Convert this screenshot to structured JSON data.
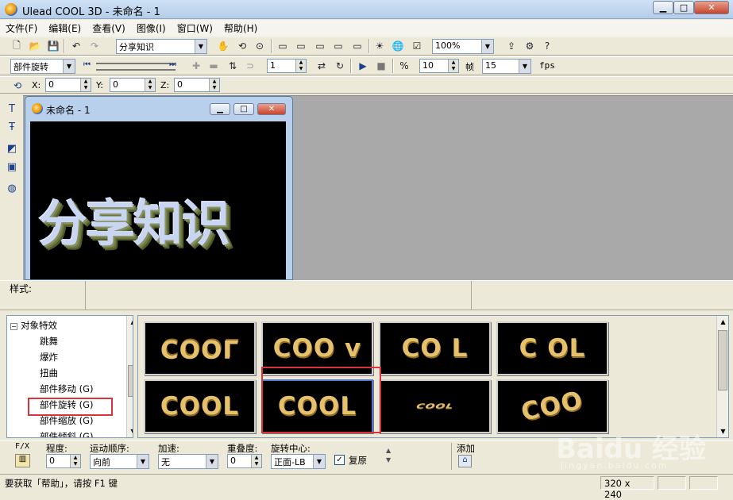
{
  "window": {
    "title": "Ulead COOL 3D - 未命名 - 1"
  },
  "menu": [
    "文件(F)",
    "编辑(E)",
    "查看(V)",
    "图像(I)",
    "窗口(W)",
    "帮助(H)"
  ],
  "toolbar1": {
    "text_combo": "分享知识",
    "zoom_combo": "100%"
  },
  "toolbar2": {
    "effect_combo": "部件旋转",
    "frame_value": "1",
    "frame_count": "10",
    "frames_label": "帧",
    "fps_value": "15",
    "fps_label": "fps"
  },
  "toolbar3": {
    "x_label": "X:",
    "x_value": "0",
    "y_label": "Y:",
    "y_value": "0",
    "z_label": "Z:",
    "z_value": "0"
  },
  "document": {
    "title": "未命名 - 1",
    "canvas_text": "分享知识"
  },
  "style_panel": {
    "label": "样式:"
  },
  "tree": {
    "root": "对象特效",
    "items": [
      "跳舞",
      "爆炸",
      "扭曲",
      "部件移动 (G)",
      "部件旋转 (G)",
      "部件缩放 (G)",
      "部件倾斜 (G)"
    ],
    "selected_index": 4
  },
  "gallery": {
    "thumbnails": [
      "COOL",
      "COO v",
      "CO L",
      "C OL",
      "COOL",
      "COOL",
      "COOL",
      "COO"
    ],
    "selected_index": 5
  },
  "properties": {
    "fx_label": "F/X",
    "degree_label": "程度:",
    "degree_value": "0",
    "motion_order_label": "运动顺序:",
    "motion_order_value": "向前",
    "accel_label": "加速:",
    "accel_value": "无",
    "overlap_label": "重叠度:",
    "overlap_value": "0",
    "rotation_center_label": "旋转中心:",
    "rotation_center_value": "正面-LB",
    "restore_label": "复原",
    "restore_checked": true,
    "add_label": "添加"
  },
  "statusbar": {
    "help_text": "要获取「帮助」，请按 F1 键",
    "size": "320 x 240"
  },
  "watermark": {
    "text": "Baidu 经验",
    "sub": "jingyan.baidu.com"
  },
  "colors": {
    "highlight": "#d9333b",
    "canvas_bg": "#000000",
    "thumb_text": "#e6c06a"
  }
}
